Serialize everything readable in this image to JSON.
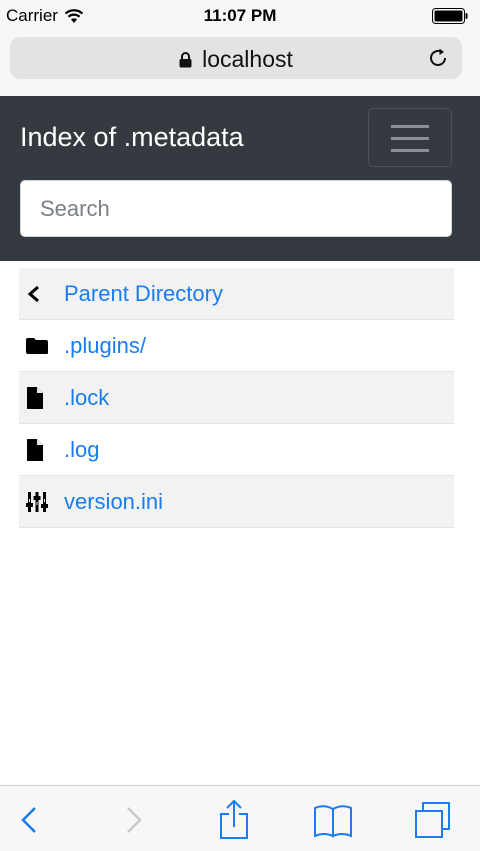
{
  "status_bar": {
    "carrier": "Carrier",
    "time": "11:07 PM"
  },
  "address_bar": {
    "url": "localhost"
  },
  "navbar": {
    "title": "Index of .metadata",
    "search_placeholder": "Search"
  },
  "listing": {
    "parent": {
      "label": "Parent Directory",
      "icon": "chevron-left-icon"
    },
    "items": [
      {
        "label": ".plugins/",
        "icon": "folder-icon"
      },
      {
        "label": ".lock",
        "icon": "file-icon"
      },
      {
        "label": ".log",
        "icon": "file-icon"
      },
      {
        "label": "version.ini",
        "icon": "settings-sliders-icon"
      }
    ]
  },
  "toolbar": {
    "back_icon": "back-chevron-icon",
    "forward_icon": "forward-chevron-icon",
    "share_icon": "share-icon",
    "bookmarks_icon": "bookmarks-icon",
    "tabs_icon": "tabs-icon"
  },
  "colors": {
    "link": "#1a7cf0",
    "navbar": "#343a40",
    "ios_blue": "#1a7cf0"
  }
}
